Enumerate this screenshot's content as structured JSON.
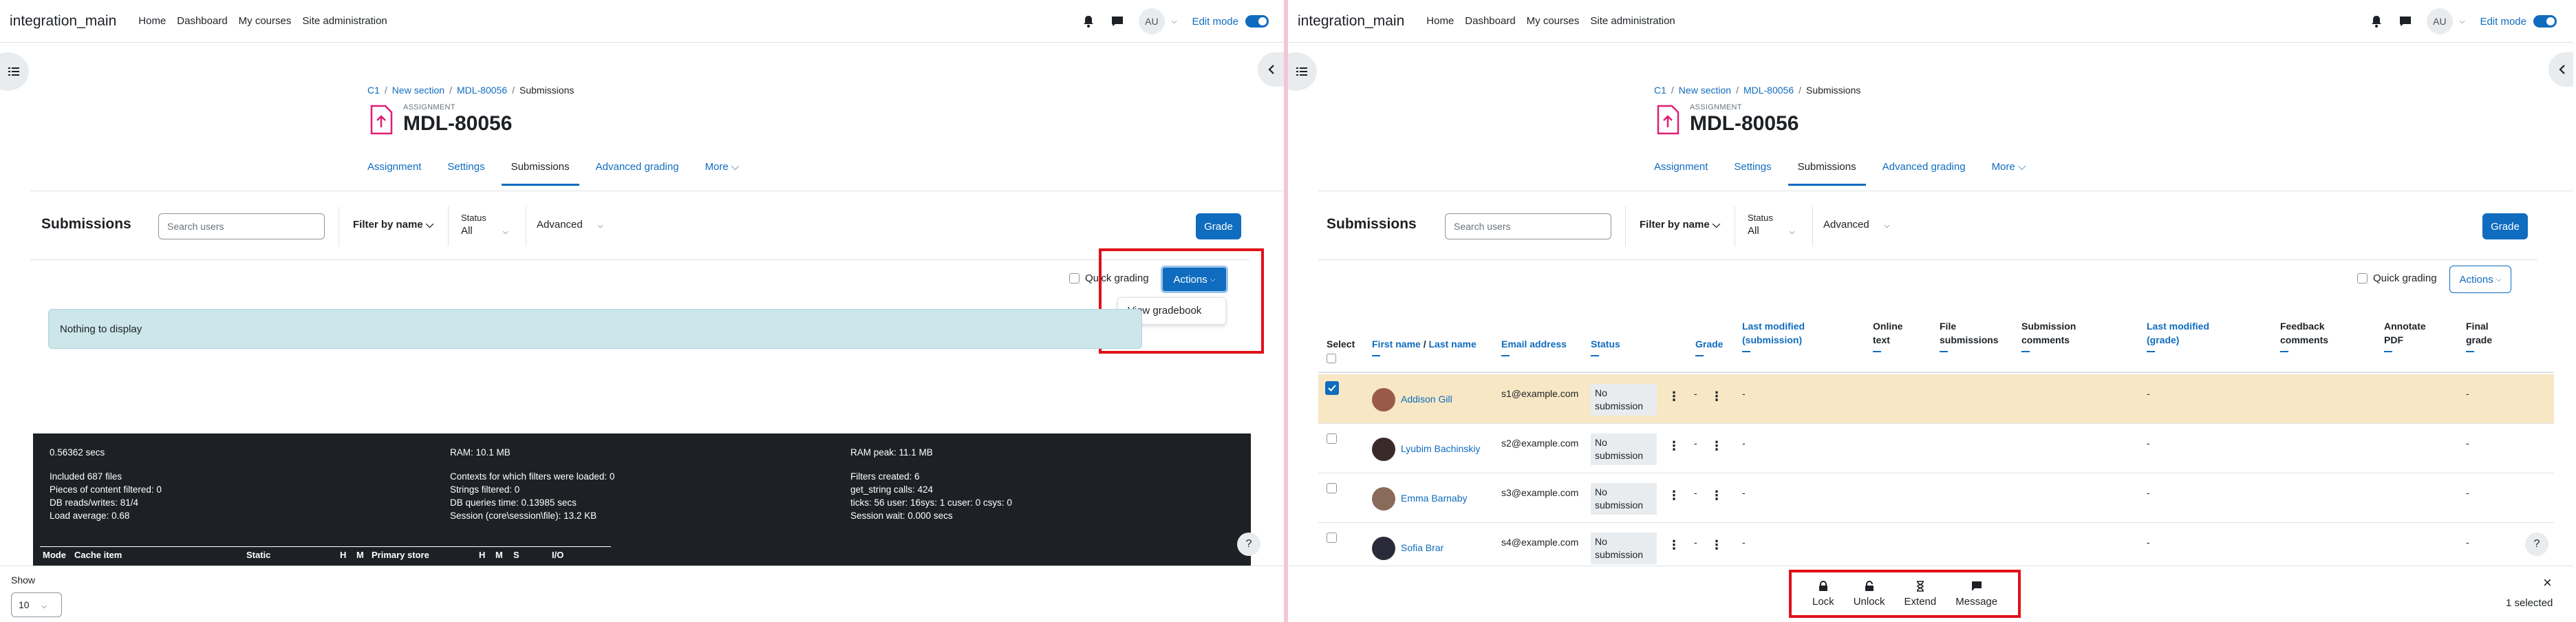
{
  "navbar": {
    "brand": "integration_main",
    "links": [
      "Home",
      "Dashboard",
      "My courses",
      "Site administration"
    ],
    "avatar_initials": "AU",
    "edit_mode_label": "Edit mode"
  },
  "breadcrumb": [
    "C1",
    "New section",
    "MDL-80056",
    "Submissions"
  ],
  "page": {
    "kicker": "ASSIGNMENT",
    "title": "MDL-80056"
  },
  "tabs": [
    "Assignment",
    "Settings",
    "Submissions",
    "Advanced grading",
    "More"
  ],
  "toolbar": {
    "title": "Submissions",
    "search_placeholder": "Search users",
    "filter_label": "Filter by name",
    "status_label": "Status",
    "status_value": "All",
    "advanced_label": "Advanced",
    "grade_button": "Grade",
    "quick_grading": "Quick grading",
    "actions_button": "Actions"
  },
  "dropdown": {
    "view_gradebook": "View gradebook"
  },
  "nothing_to_display": "Nothing to display",
  "perf": {
    "col1": [
      "0.56362 secs",
      "",
      "Included 687 files",
      "Pieces of content filtered: 0",
      "DB reads/writes: 81/4",
      "Load average: 0.68"
    ],
    "col2": [
      "RAM: 10.1 MB",
      "",
      "Contexts for which filters were loaded: 0",
      "Strings filtered: 0",
      "DB queries time: 0.13985 secs",
      "Session (core\\session\\file): 13.2 KB"
    ],
    "col3": [
      "RAM peak: 11.1 MB",
      "",
      "Filters created: 6",
      "get_string calls: 424",
      "ticks: 56 user: 16sys: 1 cuser: 0 csys: 0",
      "Session wait: 0.000 secs"
    ],
    "table_headers": [
      "Mode",
      "Cache item",
      "Static",
      "H",
      "M",
      "Primary store",
      "H",
      "M",
      "S",
      "I/O"
    ]
  },
  "footer": {
    "show_label": "Show",
    "show_value": "10",
    "bulk_actions": [
      "Lock",
      "Unlock",
      "Extend",
      "Message"
    ],
    "selected_count": "1 selected"
  },
  "table": {
    "headers": {
      "select": "Select",
      "first_name": "First name",
      "slash": "/",
      "last_name": "Last name",
      "email": "Email address",
      "status": "Status",
      "grade": "Grade",
      "last_modified_submission": "Last modified (submission)",
      "online_text": "Online text",
      "file_submissions": "File submissions",
      "submission_comments": "Submission comments",
      "last_modified_grade": "Last modified (grade)",
      "feedback_comments": "Feedback comments",
      "annotate_pdf": "Annotate PDF",
      "final_grade": "Final grade"
    },
    "rows": [
      {
        "name": "Addison Gill",
        "email": "s1@example.com",
        "status": "No submission",
        "grade": "-",
        "modified": "-",
        "modified_grade": "-",
        "final": "-",
        "selected": true
      },
      {
        "name": "Lyubim Bachinskiy",
        "email": "s2@example.com",
        "status": "No submission",
        "grade": "-",
        "modified": "-",
        "modified_grade": "-",
        "final": "-",
        "selected": false
      },
      {
        "name": "Emma Barnaby",
        "email": "s3@example.com",
        "status": "No submission",
        "grade": "-",
        "modified": "-",
        "modified_grade": "-",
        "final": "-",
        "selected": false
      },
      {
        "name": "Sofia Brar",
        "email": "s4@example.com",
        "status": "No submission",
        "grade": "-",
        "modified": "-",
        "modified_grade": "-",
        "final": "-",
        "selected": false
      }
    ]
  },
  "colors": {
    "primary": "#0f6cbf",
    "highlight_row": "#f7e7c4",
    "alert_info": "#cce6ea",
    "annotation_red": "#e0101a"
  }
}
